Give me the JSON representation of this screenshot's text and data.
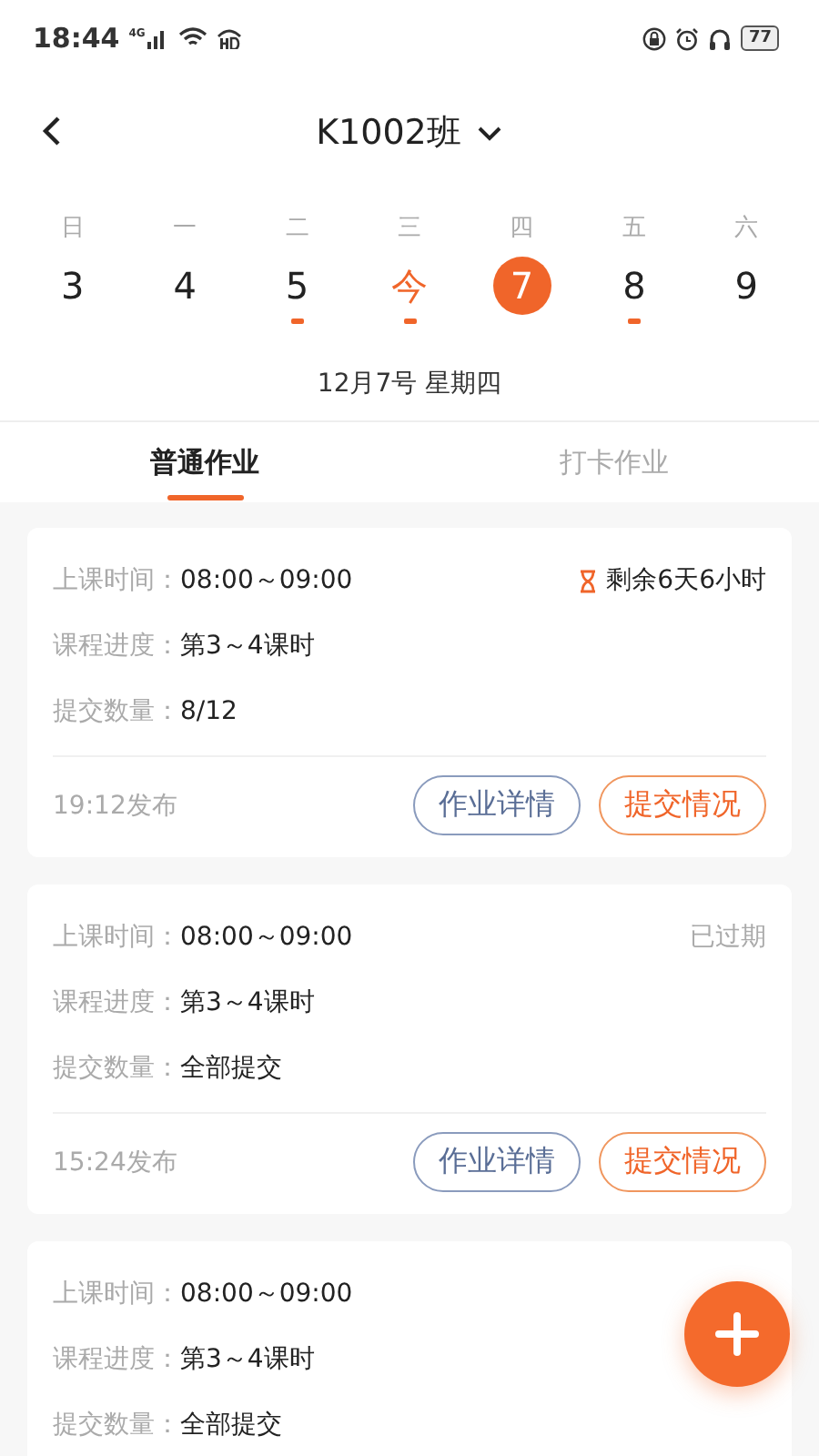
{
  "status_bar": {
    "time": "18:44",
    "network": "4G",
    "battery": "77"
  },
  "header": {
    "title": "K1002班"
  },
  "week": [
    {
      "weekday": "日",
      "date": "3",
      "today": false,
      "selected": false,
      "has_work": false
    },
    {
      "weekday": "一",
      "date": "4",
      "today": false,
      "selected": false,
      "has_work": false
    },
    {
      "weekday": "二",
      "date": "5",
      "today": false,
      "selected": false,
      "has_work": true
    },
    {
      "weekday": "三",
      "date": "今",
      "today": true,
      "selected": false,
      "has_work": true
    },
    {
      "weekday": "四",
      "date": "7",
      "today": false,
      "selected": true,
      "has_work": false
    },
    {
      "weekday": "五",
      "date": "8",
      "today": false,
      "selected": false,
      "has_work": true
    },
    {
      "weekday": "六",
      "date": "9",
      "today": false,
      "selected": false,
      "has_work": false
    }
  ],
  "selected_date": "12月7号  星期四",
  "tabs": [
    {
      "label": "普通作业",
      "selected": true
    },
    {
      "label": "打卡作业",
      "selected": false
    }
  ],
  "cards": [
    {
      "fields": [
        {
          "label": "上课时间：",
          "value": "08:00～09:00"
        },
        {
          "label": "课程进度：",
          "value": "第3～4课时"
        },
        {
          "label": "提交数量：",
          "value": "8/12"
        }
      ],
      "status": {
        "kind": "remaining",
        "text": "剩余6天6小时"
      },
      "published": "19:12发布",
      "buttons": [
        {
          "label": "作业详情",
          "kind": "secondary"
        },
        {
          "label": "提交情况",
          "kind": "primary"
        }
      ]
    },
    {
      "fields": [
        {
          "label": "上课时间：",
          "value": "08:00～09:00"
        },
        {
          "label": "课程进度：",
          "value": "第3～4课时"
        },
        {
          "label": "提交数量：",
          "value": "全部提交"
        }
      ],
      "status": {
        "kind": "expired",
        "text": "已过期"
      },
      "published": "15:24发布",
      "buttons": [
        {
          "label": "作业详情",
          "kind": "secondary"
        },
        {
          "label": "提交情况",
          "kind": "primary"
        }
      ]
    },
    {
      "fields": [
        {
          "label": "上课时间：",
          "value": "08:00～09:00"
        },
        {
          "label": "课程进度：",
          "value": "第3～4课时"
        },
        {
          "label": "提交数量：",
          "value": "全部提交"
        }
      ]
    }
  ]
}
